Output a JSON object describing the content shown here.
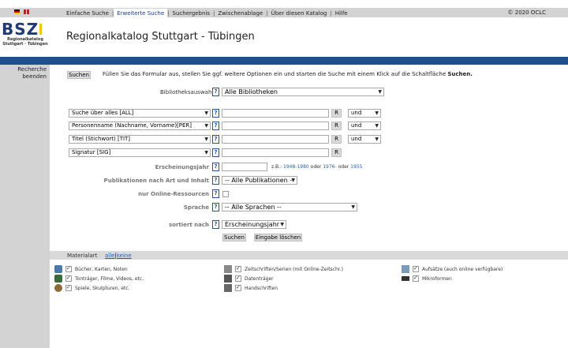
{
  "nav": {
    "items": [
      "Einfache Suche",
      "Erweiterte Suche",
      "Suchergebnis",
      "Zwischenablage",
      "Über diesen Katalog",
      "Hilfe"
    ],
    "active_index": 1,
    "copyright": "© 2020 OCLC"
  },
  "logo": {
    "text": "BSZ",
    "sub1": "Regionalkatalog",
    "sub2": "Stuttgart · Tübingen"
  },
  "site_title": "Regionalkatalog Stuttgart - Tübingen",
  "sidebar": {
    "item": "Recherche beenden"
  },
  "search_button_top": "Suchen",
  "intro": {
    "text": "Füllen Sie das Formular aus, stellen Sie ggf. weitere Optionen ein und starten die Suche mit einem Klick auf die Schaltfläche",
    "bold": "Suchen."
  },
  "library": {
    "label": "Bibliotheksauswahl",
    "help": "?",
    "value": "Alle Bibliotheken"
  },
  "fields": [
    {
      "index": "Suche über alles [ALL]",
      "value": "",
      "r": "R",
      "op": "und"
    },
    {
      "index": "Personenname (Nachname, Vorname)[PER]",
      "value": "",
      "r": "R",
      "op": "und"
    },
    {
      "index": "Titel (Stichwort) [TIT]",
      "value": "",
      "r": "R",
      "op": "und"
    },
    {
      "index": "Signatur [SIG]",
      "value": "",
      "r": "R",
      "op": ""
    }
  ],
  "year": {
    "label": "Erscheinungsjahr",
    "example_prefix": "z.B.:",
    "ex1": "1948-1980",
    "or1": "oder",
    "ex2": "1976-",
    "or2": "oder",
    "ex3": "1955"
  },
  "publications": {
    "label": "Publikationen nach Art und Inhalt",
    "value": "-- Alle Publikationen --"
  },
  "online": {
    "label": "nur Online-Ressourcen"
  },
  "language": {
    "label": "Sprache",
    "value": "-- Alle Sprachen --"
  },
  "sort": {
    "label": "sortiert nach",
    "value": "Erscheinungsjahr"
  },
  "buttons": {
    "search": "Suchen",
    "clear": "Eingabe löschen"
  },
  "materials": {
    "title": "Materialart",
    "all": "alle",
    "sep": "|",
    "none": "keine",
    "items": [
      "Bücher, Karten, Noten",
      "Tonträger, Filme, Videos, etc.",
      "Spiele, Skulpturen, etc.",
      "Zeitschriften/Serien (mit Online-Zeitschr.)",
      "Datenträger",
      "Handschriften",
      "Aufsätze (auch online verfügbare)",
      "Mikroformen"
    ]
  },
  "colors": {
    "brand_blue": "#1f4f8c",
    "link_blue": "#2a5fa8",
    "nav_grey": "#d3d3d3"
  }
}
